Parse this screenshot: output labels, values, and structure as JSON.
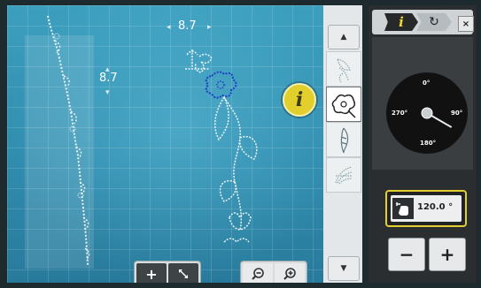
{
  "canvas": {
    "width_value_label": "8.7",
    "height_value_label": "8.7",
    "info_label": "i"
  },
  "bottom_toolbar": {
    "add_label": "+",
    "zoom_out_icon": "zoom-out-icon",
    "zoom_in_icon": "zoom-in-icon"
  },
  "design_strip": {
    "items": [
      "leaf-motif",
      "flower-motif",
      "feather-motif",
      "fan-motif"
    ],
    "selected_index": 1
  },
  "panel": {
    "info_tab_label": "i",
    "reset_tab_label": "↻",
    "close_label": "×",
    "dial_labels": {
      "top": "0°",
      "left": "270°",
      "right": "90°",
      "bottom": "180°"
    },
    "dial_angle_deg": 120,
    "rotation_value": "120.0 °",
    "minus_label": "−",
    "plus_label": "+"
  },
  "colors": {
    "canvas": "#2f8bad",
    "accent_yellow": "#e2cf2b",
    "selected_stitch": "#1e3ec8"
  }
}
